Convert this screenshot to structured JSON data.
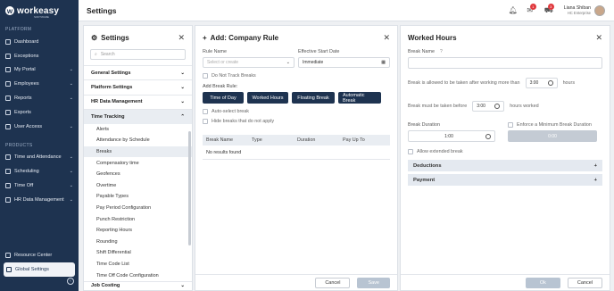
{
  "app": {
    "logo_text": "workeasy",
    "logo_tag": "SOFTWARE"
  },
  "sidebar": {
    "platform_label": "PLATFORM",
    "platform_items": [
      {
        "label": "Dashboard",
        "icon": "dashboard-icon"
      },
      {
        "label": "Exceptions",
        "icon": "exceptions-icon"
      },
      {
        "label": "My Portal",
        "icon": "portal-icon"
      },
      {
        "label": "Employees",
        "icon": "employees-icon"
      },
      {
        "label": "Reports",
        "icon": "reports-icon"
      },
      {
        "label": "Exports",
        "icon": "exports-icon"
      },
      {
        "label": "User Access",
        "icon": "user-access-icon"
      }
    ],
    "products_label": "PRODUCTS",
    "product_items": [
      {
        "label": "Time and Attendance"
      },
      {
        "label": "Scheduling"
      },
      {
        "label": "Time Off"
      },
      {
        "label": "HR Data Management"
      }
    ],
    "resource_center": "Resource Center",
    "global_settings": "Global Settings"
  },
  "topbar": {
    "title": "Settings",
    "msg_badge": "1",
    "cart_badge": "3",
    "user_name": "Liana Shiban",
    "user_org": "HC Enterprise"
  },
  "settings_panel": {
    "title": "Settings",
    "search_placeholder": "Search",
    "sections": [
      {
        "label": "General Settings",
        "open": false
      },
      {
        "label": "Platform Settings",
        "open": false
      },
      {
        "label": "HR Data Management",
        "open": false
      }
    ],
    "time_tracking": {
      "label": "Time Tracking",
      "items": [
        "Alerts",
        "Attendance by Schedule",
        "Breaks",
        "Compensatory time",
        "Geofences",
        "Overtime",
        "Payable Types",
        "Pay Period Configuration",
        "Punch Restriction",
        "Reporting Hours",
        "Rounding",
        "Shift Differential",
        "Time Code List",
        "Time Off Code Configuration"
      ],
      "selected": "Breaks"
    },
    "next_section": "Job Costing"
  },
  "company_rule": {
    "title": "Add: Company Rule",
    "rule_name_label": "Rule Name",
    "rule_name_placeholder": "Select or create",
    "start_date_label": "Effective Start Date",
    "start_date_value": "Immediate",
    "do_not_track": "Do Not Track Breaks",
    "add_break_rule_label": "Add Break Rule:",
    "rule_buttons": [
      "Time of Day",
      "Worked Hours",
      "Floating Break",
      "Automatic Break"
    ],
    "auto_select": "Auto-select break",
    "hide_breaks": "Hide breaks that do not apply",
    "table_headers": [
      "Break Name",
      "Type",
      "Duration",
      "Pay Up To"
    ],
    "empty_text": "No results found",
    "cancel": "Cancel",
    "save": "Save"
  },
  "worked_hours": {
    "title": "Worked Hours",
    "break_name_label": "Break Name",
    "allowed_prefix": "Break is allowed to be taken after working more than",
    "allowed_value": "3:00",
    "allowed_suffix": "hours",
    "must_prefix": "Break must be taken before",
    "must_value": "3:00",
    "must_suffix": "hours worked",
    "duration_label": "Break Duration",
    "duration_value": "1:00",
    "enforce_label": "Enforce a Minimum Break Duration",
    "enforce_value": "0:00",
    "allow_extended": "Allow extended break",
    "deductions": "Deductions",
    "payment": "Payment",
    "ok": "Ok",
    "cancel": "Cancel"
  },
  "colors": {
    "sidebar_bg": "#1e3350",
    "accent": "#1e3350",
    "badge": "#e0393e"
  }
}
